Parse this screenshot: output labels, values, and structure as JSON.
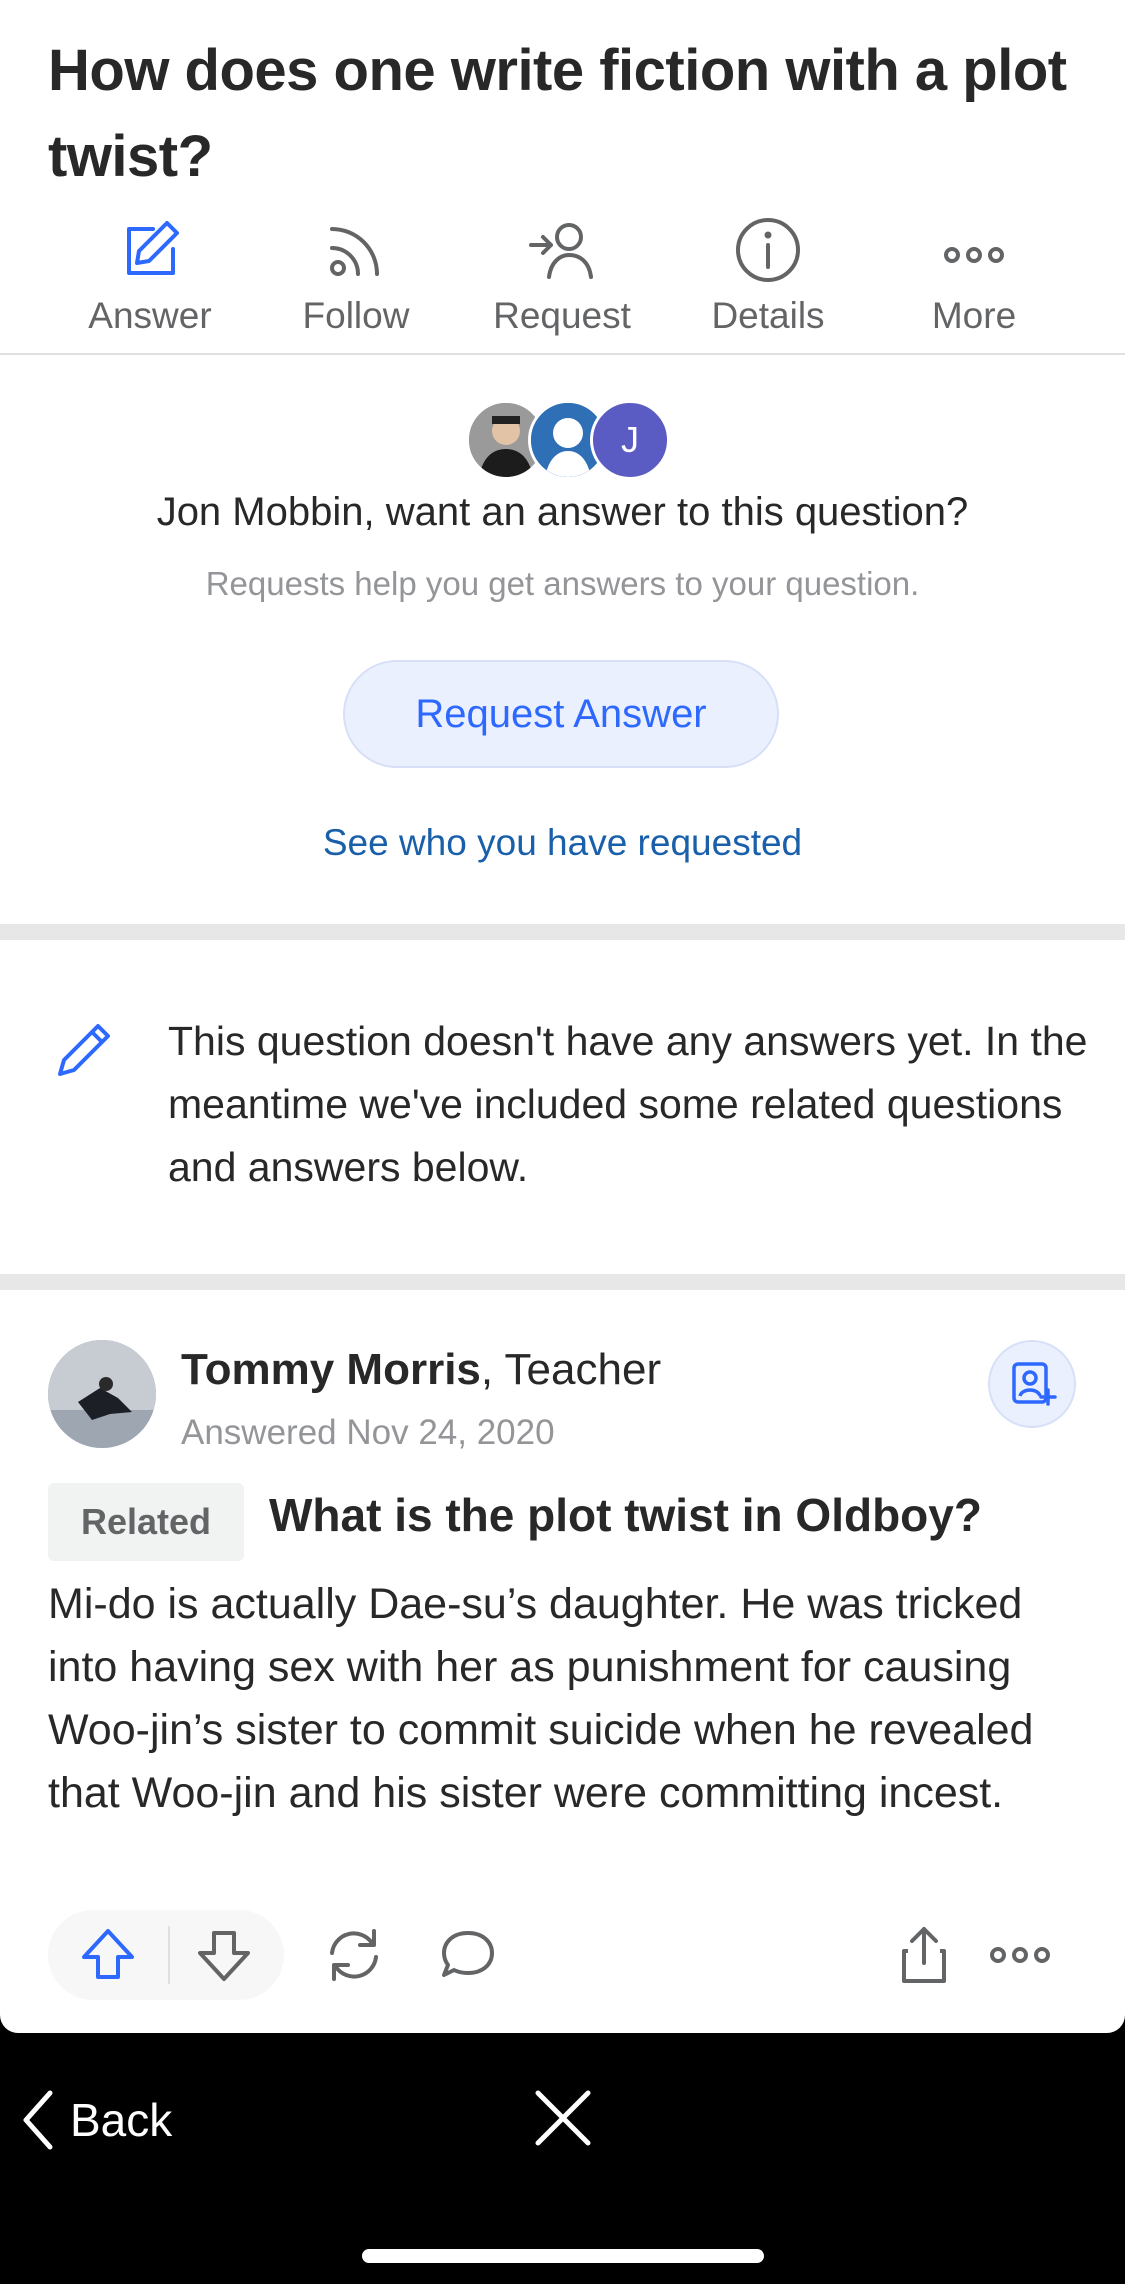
{
  "question": {
    "title": "How does one write fiction with a plot twist?"
  },
  "actions": [
    {
      "label": "Answer",
      "icon": "pencil-square-icon"
    },
    {
      "label": "Follow",
      "icon": "rss-follow-icon"
    },
    {
      "label": "Request",
      "icon": "request-person-icon"
    },
    {
      "label": "Details",
      "icon": "info-circle-icon"
    },
    {
      "label": "More",
      "icon": "more-dots-icon"
    }
  ],
  "request_card": {
    "avatar_initial": "J",
    "heading": "Jon Mobbin, want an answer to this question?",
    "subtext": "Requests help you get answers to your question.",
    "button_label": "Request Answer",
    "link_label": "See who you have requested"
  },
  "notice": {
    "text": "This question doesn't have any answers yet. In the meantime we've included some related questions and answers below."
  },
  "answer": {
    "author_name": "Tommy Morris",
    "author_credential": ", Teacher",
    "answered_date": "Answered Nov 24, 2020",
    "related_tag": "Related",
    "related_question": "What is the plot twist in Oldboy?",
    "body": "Mi-do is actually Dae-su’s daughter. He was tricked into having sex with her as punishment for causing Woo-jin’s sister to commit suicide when he revealed that Woo-jin and his sister were committing incest."
  },
  "bottom_bar": {
    "back_label": "Back"
  },
  "colors": {
    "accent": "#2e69ff",
    "link": "#195faa",
    "muted": "#939598"
  }
}
